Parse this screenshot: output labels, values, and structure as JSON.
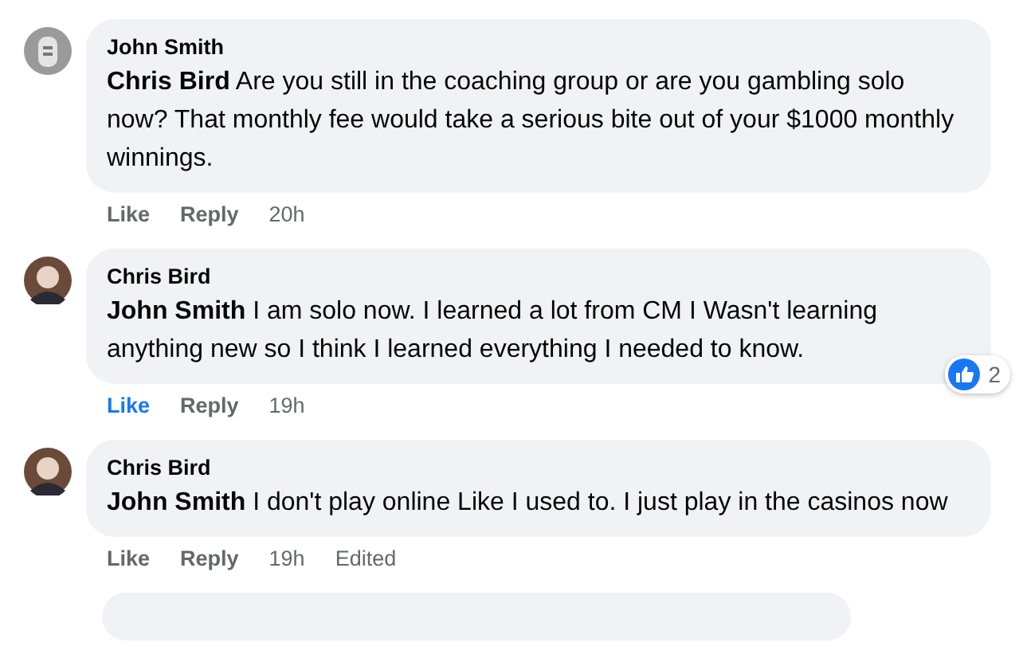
{
  "comments": [
    {
      "author": "John Smith",
      "mention": "Chris Bird",
      "text": "Are you still in the coaching group or are you gambling solo now? That monthly fee would take a serious bite out of your $1000 monthly winnings.",
      "like": {
        "label": "Like",
        "selected": false
      },
      "reply": "Reply",
      "time": "20h",
      "kind": "sign"
    },
    {
      "author": "Chris Bird",
      "mention": "John Smith",
      "text": "I am solo now. I learned a lot from CM I Wasn't learning anything new so I think I learned everything I needed to know.",
      "like": {
        "label": "Like",
        "selected": true
      },
      "reply": "Reply",
      "time": "19h",
      "reactions": "2",
      "kind": "person"
    },
    {
      "author": "Chris Bird",
      "mention": "John Smith",
      "text": "I don't play online Like I used to. I just play in the casinos now",
      "like": {
        "label": "Like",
        "selected": false
      },
      "reply": "Reply",
      "time": "19h",
      "edited": "Edited",
      "kind": "person"
    }
  ]
}
